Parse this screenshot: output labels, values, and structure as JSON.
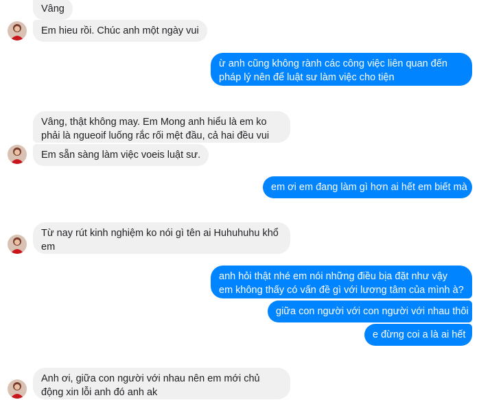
{
  "messages": [
    {
      "text": "Vâng",
      "side": "in"
    },
    {
      "text": "Em hieu rồi. Chúc anh một ngày vui",
      "side": "in"
    },
    {
      "text": "ừ anh cũng không rành các công việc liên quan đến pháp lý nên để luật sư làm việc cho tiện",
      "side": "out"
    },
    {
      "text": "Vâng, thật không may. Em Mong anh hiểu là em ko phải là ngueoif luống rắc rối mệt đầu, cả hai đều vui",
      "side": "in"
    },
    {
      "text": "Em sẵn sàng làm việc voeis luật sư.",
      "side": "in"
    },
    {
      "text": "em ơi em đang làm gì hơn ai hết em biết mà",
      "side": "out"
    },
    {
      "text": "Từ nay rút kinh nghiệm ko nói gì tên ai Huhuhuhu khổ em",
      "side": "in"
    },
    {
      "text": "anh hỏi thật nhé em nói những điều bịa đặt như vậy em không thấy có vấn đề gì với lương tâm của mình à?",
      "side": "out"
    },
    {
      "text": "giữa con người với con người với nhau thôi",
      "side": "out"
    },
    {
      "text": "e đừng coi a là ai hết",
      "side": "out"
    },
    {
      "text": "Anh ơi, giữa con người với nhau nên em mới chủ động xin lỗi anh đó anh ak",
      "side": "in"
    }
  ],
  "colors": {
    "incoming_bubble": "#f1f0f0",
    "outgoing_bubble": "#0084ff",
    "incoming_text": "#1c1e21",
    "outgoing_text": "#ffffff"
  },
  "avatar_icon": "contact-avatar-icon"
}
